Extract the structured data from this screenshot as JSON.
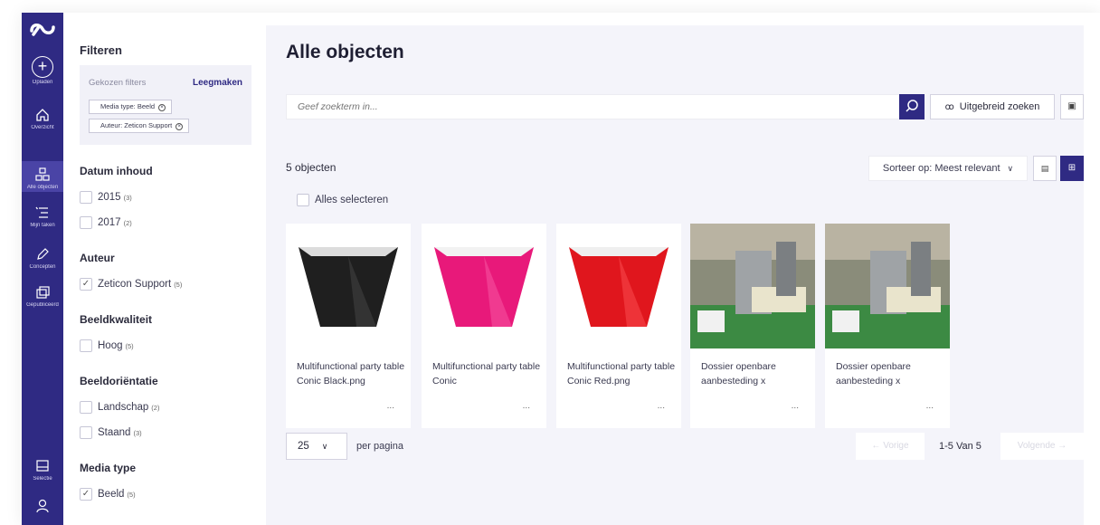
{
  "rail": {
    "items": [
      {
        "label": "Opladen",
        "icon": "plus-circle-icon"
      },
      {
        "label": "Overzicht",
        "icon": "home-icon"
      },
      {
        "label": "Alle objecten",
        "icon": "objects-icon"
      },
      {
        "label": "Mijn taken",
        "icon": "tasks-icon"
      },
      {
        "label": "Concepten",
        "icon": "pencil-icon"
      },
      {
        "label": "Gepubliceerd",
        "icon": "published-icon"
      },
      {
        "label": "Selectie",
        "icon": "selection-icon"
      },
      {
        "label": "",
        "icon": "user-icon"
      }
    ]
  },
  "filters": {
    "title": "Filteren",
    "chosen_label": "Gekozen filters",
    "clear_label": "Leegmaken",
    "chips": [
      "Media type: Beeld",
      "Auteur: Zeticon Support"
    ],
    "sections": [
      {
        "title": "Datum inhoud",
        "options": [
          {
            "label": "2015",
            "count": "(3)",
            "checked": false
          },
          {
            "label": "2017",
            "count": "(2)",
            "checked": false
          }
        ]
      },
      {
        "title": "Auteur",
        "options": [
          {
            "label": "Zeticon Support",
            "count": "(5)",
            "checked": true
          }
        ]
      },
      {
        "title": "Beeldkwaliteit",
        "options": [
          {
            "label": "Hoog",
            "count": "(5)",
            "checked": false
          }
        ]
      },
      {
        "title": "Beeldoriëntatie",
        "options": [
          {
            "label": "Landschap",
            "count": "(2)",
            "checked": false
          },
          {
            "label": "Staand",
            "count": "(3)",
            "checked": false
          }
        ]
      },
      {
        "title": "Media type",
        "options": [
          {
            "label": "Beeld",
            "count": "(5)",
            "checked": true
          }
        ]
      }
    ]
  },
  "main": {
    "title": "Alle objecten",
    "search_placeholder": "Geef zoekterm in...",
    "advanced_search": "Uitgebreid zoeken",
    "count": "5 objecten",
    "select_all": "Alles selecteren",
    "sort": "Sorteer op: Meest relevant",
    "cards": [
      {
        "name": "Multifunctional party table Conic Black.png",
        "color": "#1f1f1f"
      },
      {
        "name": "Multifunctional party table Conic",
        "color": "#e8197a"
      },
      {
        "name": "Multifunctional party table Conic Red.png",
        "color": "#e0161d"
      },
      {
        "name": "Dossier openbare aanbesteding x",
        "color": "photo"
      },
      {
        "name": "Dossier openbare aanbesteding x",
        "color": "photo"
      }
    ],
    "more": "...",
    "per_page_value": "25",
    "per_page_label": "per pagina",
    "prev": "← Vorige",
    "range": "1-5 Van 5",
    "next": "Volgende →"
  },
  "colors": {
    "brand": "#2f2a83"
  }
}
